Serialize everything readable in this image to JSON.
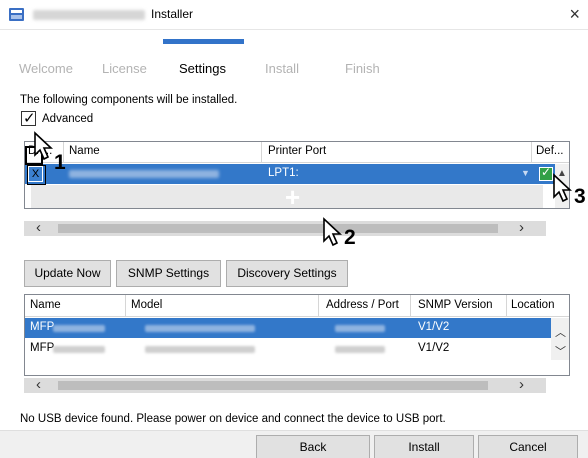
{
  "window": {
    "title": "Installer",
    "close_glyph": "×"
  },
  "steps": [
    "Welcome",
    "License",
    "Settings",
    "Install",
    "Finish"
  ],
  "active_step": "Settings",
  "intro_text": "The following components will be installed.",
  "advanced": {
    "label": "Advanced",
    "checked": true
  },
  "ports_table": {
    "columns": [
      "Dri...",
      "Name",
      "Printer Port",
      "Def..."
    ],
    "row": {
      "select_mark": "X",
      "port": "LPT1:",
      "default_checked": true
    },
    "add_glyph": "+"
  },
  "buttons": {
    "update_now": "Update Now",
    "snmp_settings": "SNMP Settings",
    "discovery_settings": "Discovery Settings"
  },
  "devices_table": {
    "columns": [
      "Name",
      "Model",
      "Address / Port",
      "SNMP Version",
      "Location"
    ],
    "rows": [
      {
        "name": "MFP",
        "snmp_version": "V1/V2",
        "selected": true
      },
      {
        "name": "MFP",
        "snmp_version": "V1/V2",
        "selected": false
      }
    ]
  },
  "status_text": "No USB device found. Please power on device and connect the device to USB port.",
  "footer": {
    "back": "Back",
    "install": "Install",
    "cancel": "Cancel"
  },
  "callouts": [
    "1",
    "2",
    "3"
  ],
  "icons": {
    "app": "installer-app-icon",
    "close": "close-icon",
    "cursor": "mouse-pointer-icon",
    "scroll_left": "chevron-left-icon",
    "scroll_right": "chevron-right-icon",
    "scroll_up": "chevron-up-icon",
    "scroll_down": "chevron-down-icon"
  },
  "colors": {
    "selection": "#3378c9",
    "step_indicator": "#3273c9",
    "default_check": "#31a046"
  }
}
